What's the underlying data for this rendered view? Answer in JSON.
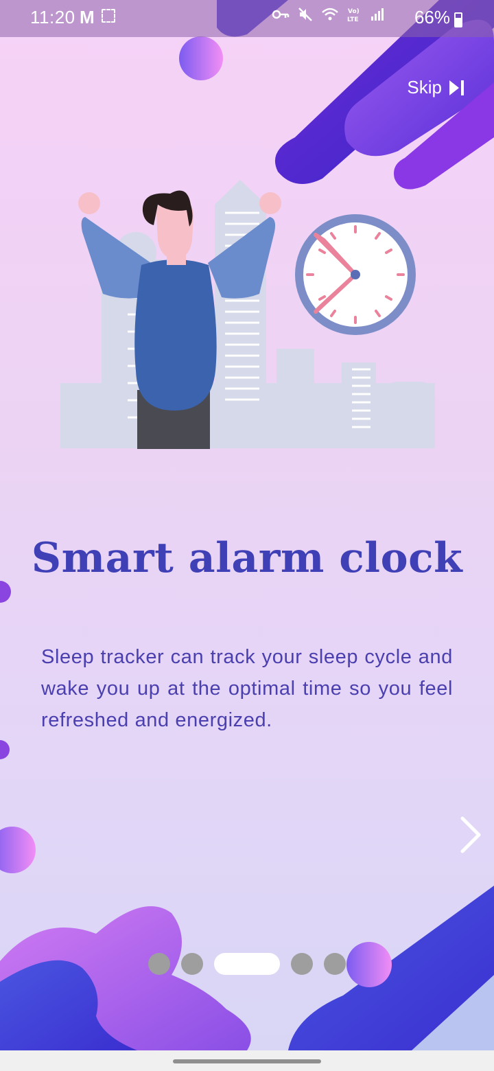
{
  "status_bar": {
    "time": "11:20",
    "mail_icon": "gmail-icon",
    "battery_percent": "66%",
    "icons": [
      "key-icon",
      "mute-icon",
      "wifi-6-icon",
      "volte-icon",
      "signal-icon",
      "battery-icon"
    ]
  },
  "onboarding": {
    "skip_label": "Skip",
    "skip_icon": "skip-next-icon",
    "title": "Smart alarm clock",
    "description": "Sleep tracker can track your sleep cycle and wake you up at the optimal time so you feel refreshed and energized.",
    "next_icon": "chevron-right-icon",
    "page_count": 5,
    "active_page": 3
  },
  "colors": {
    "title": "#3f3fb6",
    "description": "#4a3fae",
    "accent_purple": "#7b3fe0",
    "accent_blue": "#4a35d4",
    "accent_pink": "#f08cf5",
    "dot_inactive": "#9e9e9e",
    "dot_active": "#ffffff"
  }
}
